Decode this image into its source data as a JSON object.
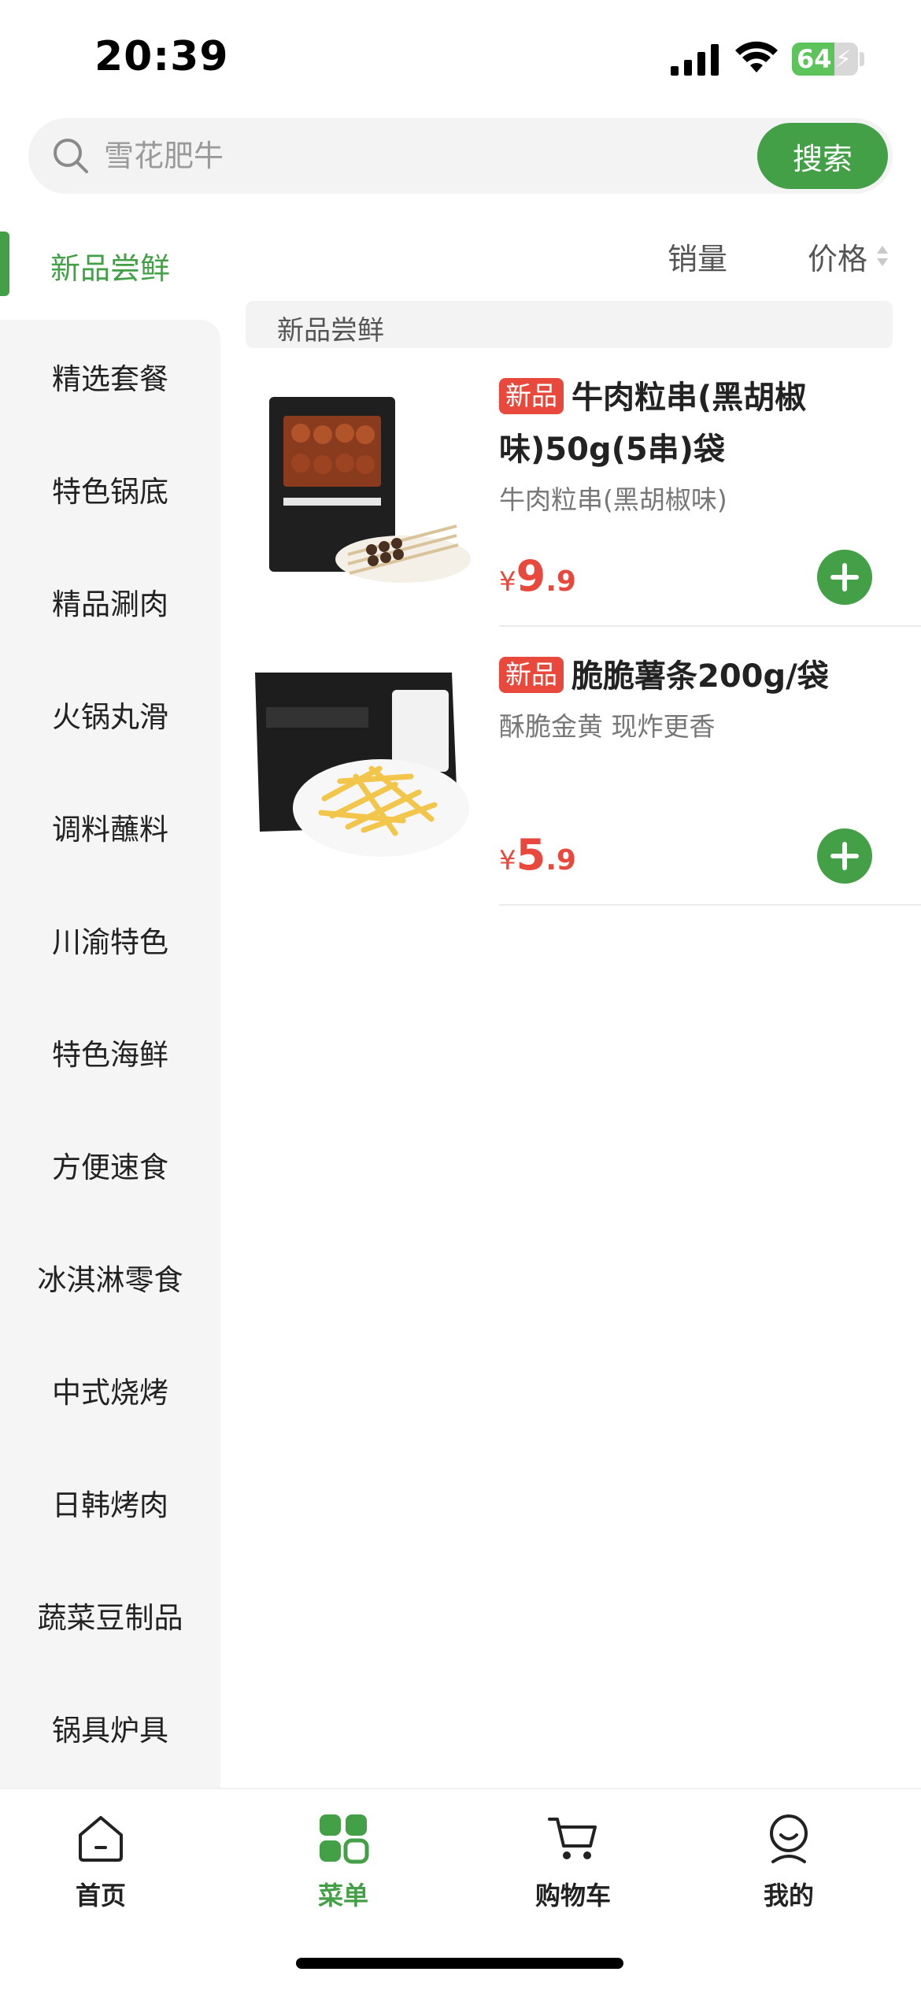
{
  "status_bar": {
    "time": "20:39",
    "battery": "64"
  },
  "search": {
    "placeholder": "雪花肥牛",
    "button_label": "搜索"
  },
  "sidebar": {
    "active": "新品尝鲜",
    "items": [
      "精选套餐",
      "特色锅底",
      "精品涮肉",
      "火锅丸滑",
      "调料蘸料",
      "川渝特色",
      "特色海鲜",
      "方便速食",
      "冰淇淋零食",
      "中式烧烤",
      "日韩烤肉",
      "蔬菜豆制品",
      "锅具炉具"
    ]
  },
  "sort": {
    "sales": "销量",
    "price": "价格"
  },
  "section_title": "新品尝鲜",
  "products": [
    {
      "tag": "新品",
      "title": "牛肉粒串(黑胡椒味)50g(5串)袋",
      "subtitle": "牛肉粒串(黑胡椒味)",
      "currency": "¥",
      "price_int": "9",
      "price_dec": ".9"
    },
    {
      "tag": "新品",
      "title": "脆脆薯条200g/袋",
      "subtitle": "酥脆金黄 现炸更香",
      "currency": "¥",
      "price_int": "5",
      "price_dec": ".9"
    }
  ],
  "tabbar": {
    "home": "首页",
    "menu": "菜单",
    "cart": "购物车",
    "mine": "我的",
    "active": "菜单"
  },
  "colors": {
    "brand_green": "#43a047",
    "price_red": "#e8493c"
  }
}
